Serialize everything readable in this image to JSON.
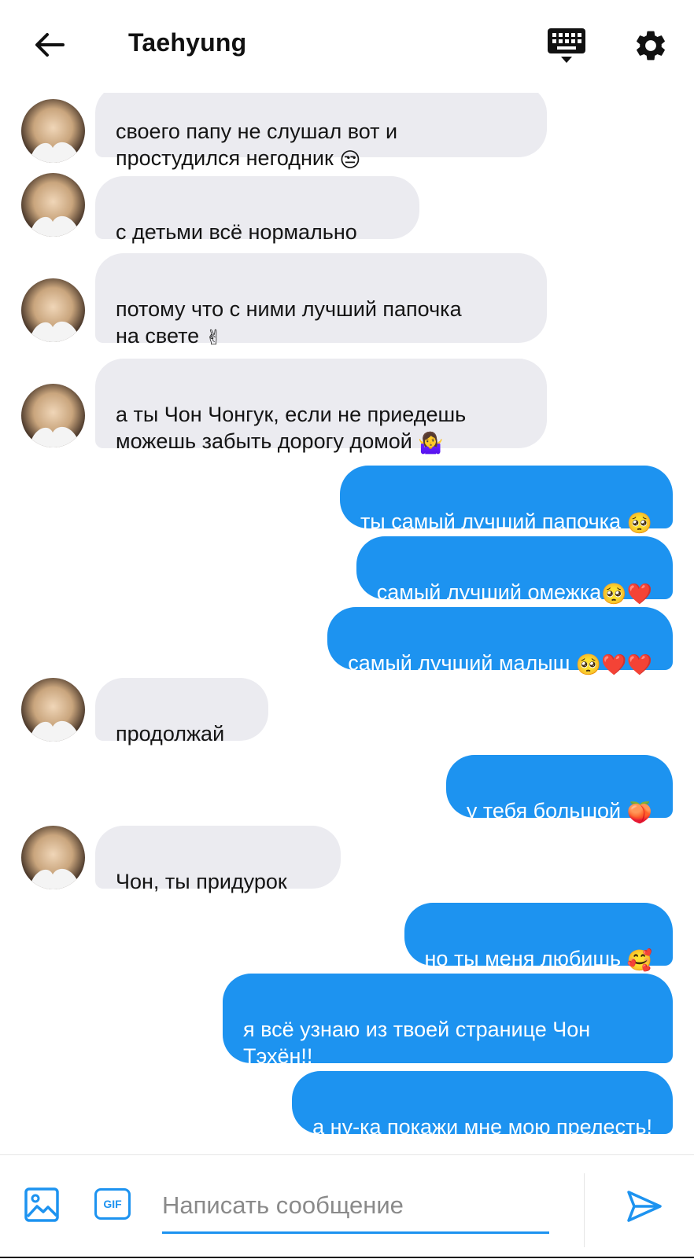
{
  "header": {
    "title": "Taehyung"
  },
  "colors": {
    "accent": "#1d93f0",
    "incoming_bubble": "#ebebf0",
    "outgoing_text": "#ffffff"
  },
  "messages": [
    {
      "side": "in",
      "text": "своего папу не слушал вот и\nпростудился негодник",
      "emoji": "😒"
    },
    {
      "side": "in",
      "text": "с детьми всё нормально",
      "emoji": ""
    },
    {
      "side": "in",
      "text": "потому что с ними лучший папочка\nна свете",
      "emoji": "✌"
    },
    {
      "side": "in",
      "text": "а ты Чон Чонгук, если не приедешь\nможешь забыть дорогу домой",
      "emoji": "🤷‍♀️"
    },
    {
      "side": "out",
      "text": "ты самый лучший папочка",
      "emoji": "🥺"
    },
    {
      "side": "out",
      "text": "самый лучший омежка",
      "emoji": "🥺❤️"
    },
    {
      "side": "out",
      "text": "самый лучший малыш",
      "emoji": "🥺❤️❤️"
    },
    {
      "side": "in",
      "text": "продолжай",
      "emoji": ""
    },
    {
      "side": "out",
      "text": "у тебя большой",
      "emoji": "🍑"
    },
    {
      "side": "in",
      "text": "Чон, ты придурок",
      "emoji": ""
    },
    {
      "side": "out",
      "text": "но ты меня любишь",
      "emoji": "🥰"
    },
    {
      "side": "out",
      "text": "я всё узнаю из твоей странице Чон\nТэхён!!",
      "emoji": ""
    },
    {
      "side": "out",
      "text": "а ну-ка покажи мне мою прелесть!",
      "emoji": ""
    }
  ],
  "composer": {
    "placeholder": "Написать сообщение",
    "gif_label": "GIF"
  },
  "icons": {
    "back": "arrow-left-icon",
    "keyboard": "keyboard-icon",
    "settings": "gear-icon",
    "image": "image-icon",
    "gif": "gif-icon",
    "send": "send-icon"
  }
}
